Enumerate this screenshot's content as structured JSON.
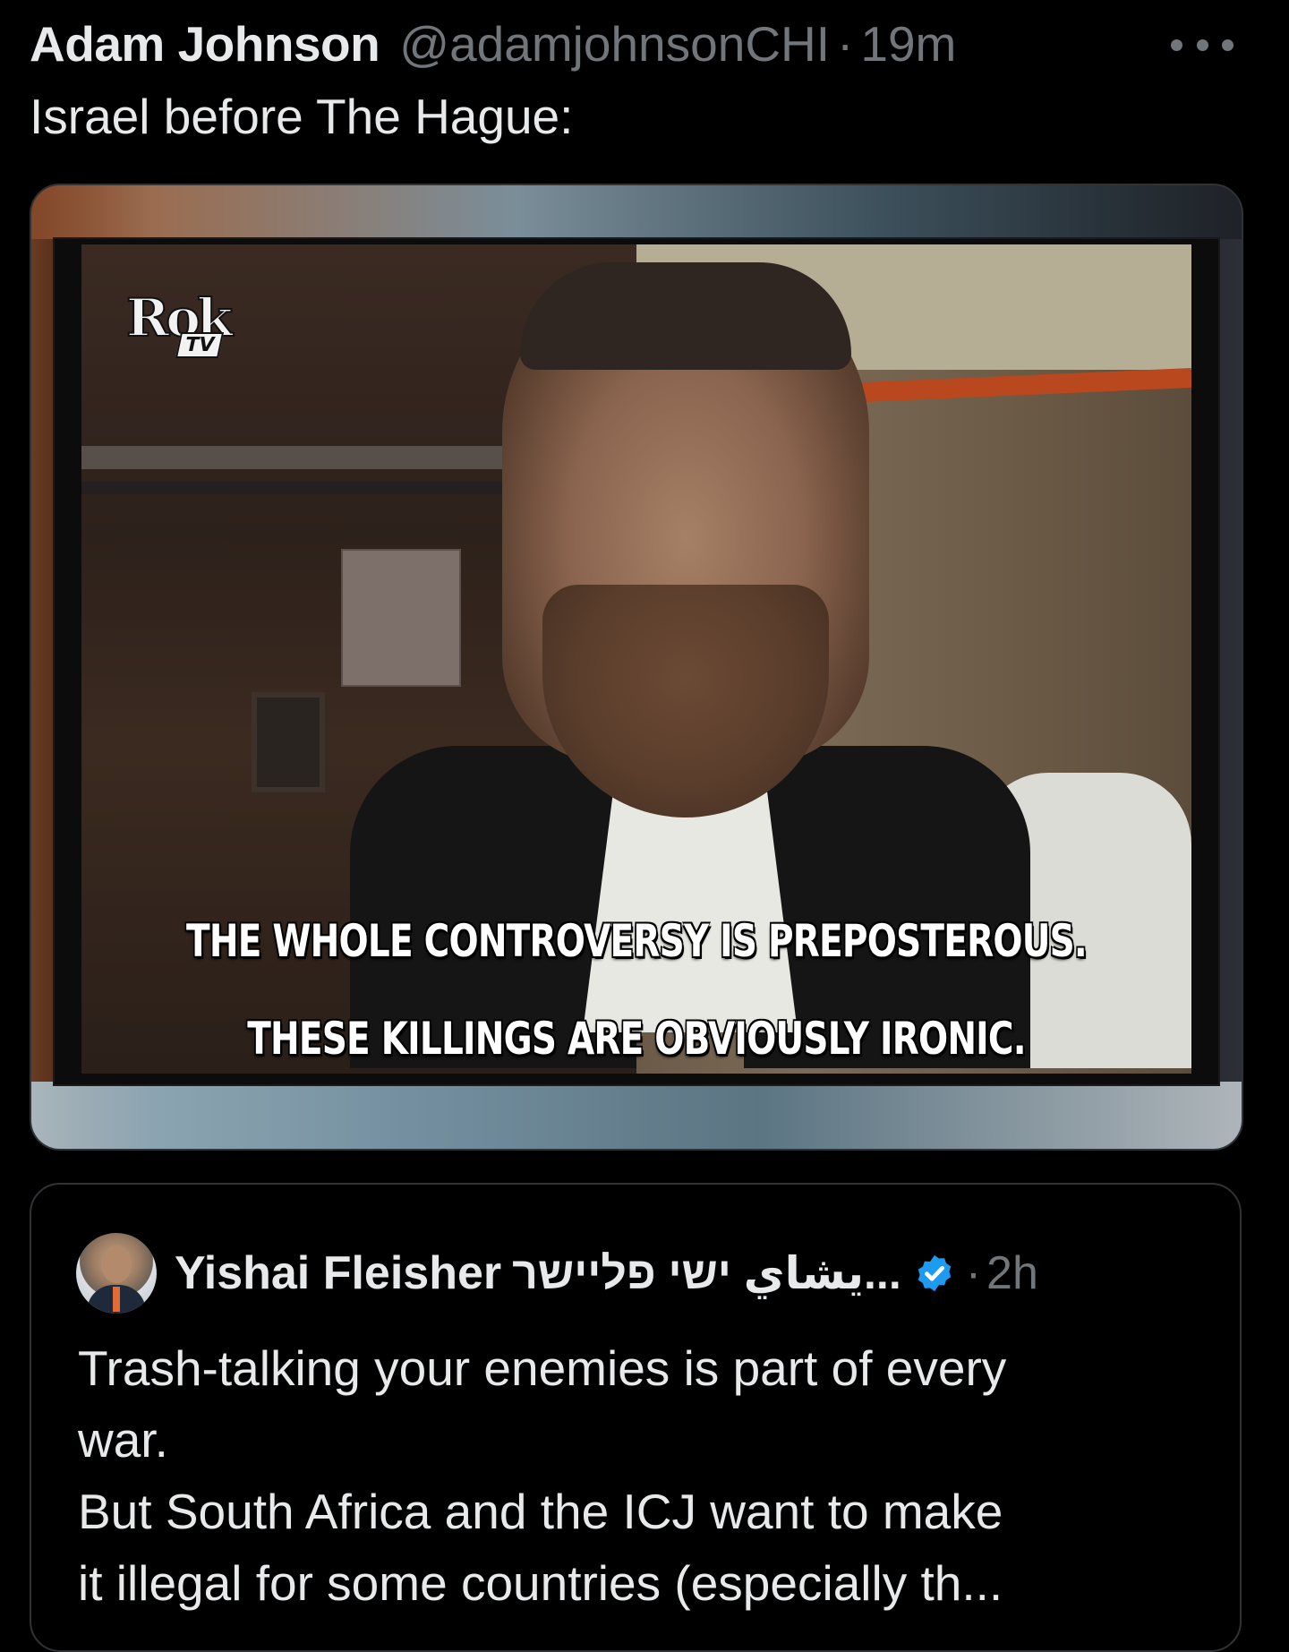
{
  "tweet": {
    "author_name": "Adam Johnson",
    "author_handle": "@adamjohnsonCHI",
    "separator": "·",
    "time": "19m",
    "text": "Israel before The Hague:",
    "more_icon": "more-dots-icon"
  },
  "media": {
    "logo_text": "Rok",
    "logo_sub": "TV",
    "caption_line_1": "THE WHOLE CONTROVERSY IS PREPOSTEROUS.",
    "caption_line_2": "THESE KILLINGS ARE OBVIOUSLY IRONIC."
  },
  "quote": {
    "author_name": "Yishai Fleisher",
    "author_name_alt": "يشاي ישי פליישר...",
    "verified_icon": "verified-badge-icon",
    "separator": "·",
    "time": "2h",
    "text_lines": [
      "Trash-talking your enemies is part of every",
      "war.",
      "But South Africa and the ICJ want to make",
      "it illegal for some countries (especially th..."
    ]
  },
  "colors": {
    "background": "#000000",
    "primary_text": "#e7e9ea",
    "secondary_text": "#71767b",
    "border": "#2f3336",
    "verified": "#1d9bf0"
  }
}
